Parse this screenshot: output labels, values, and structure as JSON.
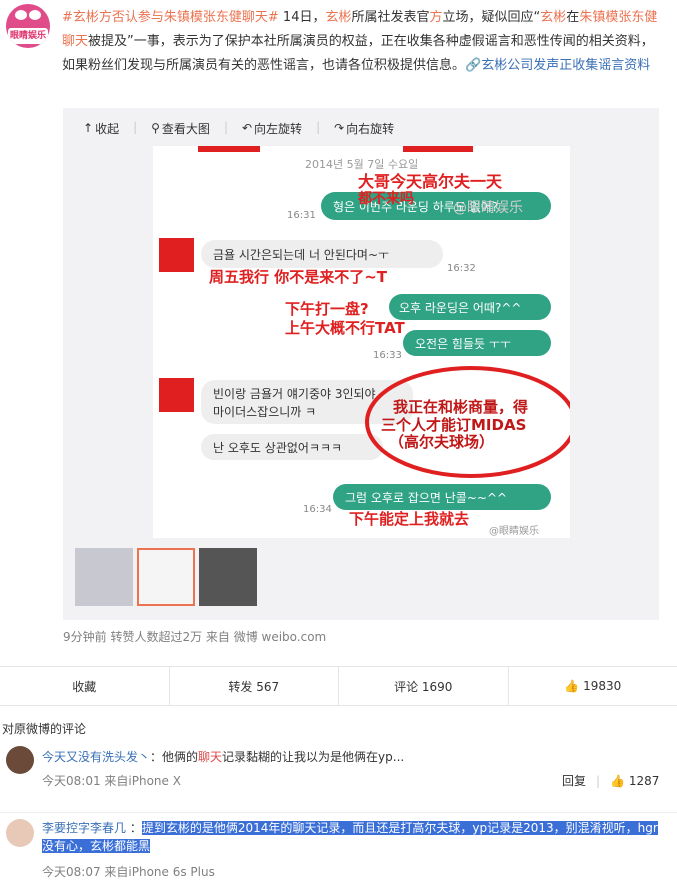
{
  "post": {
    "avatar_badge": "眼睛娱乐",
    "tag1": "#玄彬方否认参与朱镇模张东健聊天#",
    "text1": " 14日，",
    "link1": "玄彬",
    "text2": "所属社发表官",
    "tag2": "方",
    "text3": "立场，疑似回应“",
    "link2": "玄彬",
    "text4": "在",
    "tag3": "朱镇模张东健聊天",
    "text5": "被提及”一事，表示为了保护本社所属演员的权益，正在收集各种虚假谣言和恶性传闻的相关资料，如果粉丝们发现与所属演员有关的恶性谣言，也请各位积极提供信息。",
    "link3": "玄彬公司发声正收集谣言资料"
  },
  "media": {
    "tools": [
      {
        "icon": "collapse-icon",
        "glyph": "↑",
        "label": "收起"
      },
      {
        "icon": "zoom-icon",
        "glyph": "⚲",
        "label": "查看大图"
      },
      {
        "icon": "rotate-left-icon",
        "glyph": "↶",
        "label": "向左旋转"
      },
      {
        "icon": "rotate-right-icon",
        "glyph": "↷",
        "label": "向右旋转"
      }
    ],
    "chat": {
      "date": "2014년 5월 7일 수요일",
      "m1_ko": "형은 이번주 라운딩 하루도 없어?",
      "m1_cn": "大哥今天高尔夫一天",
      "m1_cn2": "都不来吗",
      "m1_time": "16:31",
      "m2_ko": "금욜 시간은되는데 너 안된다며~ㅜ",
      "m2_cn": "周五我行 你不是来不了~T",
      "m2_time": "16:32",
      "m3_ko": "오후 라운딩은 어때?^^",
      "m3_cn": "下午打一盘?",
      "m4_ko": "오전은 힘들듯 ㅜㅜ",
      "m4_cn": "上午大概不行TAT",
      "m4_time": "16:33",
      "m5_ko1": "빈이랑 금욜거 얘기중야 3인되야",
      "m5_ko2": "마이더스잡으니까 ㅋ",
      "m5_cn1": "我正在和彬商量，得",
      "m5_cn2": "三个人才能订MIDAS",
      "m5_cn3": "（高尔夫球场）",
      "m6_ko": "난 오후도 상관없어ㅋㅋㅋ",
      "m7_ko": "그럼 오후로 잡으면 난콜~~^^",
      "m7_cn": "下午能定上我就去",
      "m7_time": "16:34",
      "watermark": "@眼睛娱乐"
    }
  },
  "meta": "9分钟前 转赞人数超过2万  来自 微博 weibo.com",
  "actions": {
    "fav": "收藏",
    "repost": "转发 567",
    "comment": "评论 1690",
    "like": "19830"
  },
  "comments_title": "对原微博的评论",
  "comments": [
    {
      "user": "今天又没有洗头发丶",
      "text_a": "：他俩的",
      "text_tag": "聊天",
      "text_b": "记录黏糊的让我以为是他俩在yp...",
      "meta": "今天08:01 来自iPhone X",
      "reply": "回复",
      "likes": "1287"
    },
    {
      "user": "李要控字李春几",
      "text": "提到玄彬的是他俩2014年的聊天记录，而且还是打高尔夫球，yp记录是2013，别混淆视听，hgr没有心，玄彬都能黑",
      "meta": "今天08:07 来自iPhone 6s Plus"
    }
  ]
}
